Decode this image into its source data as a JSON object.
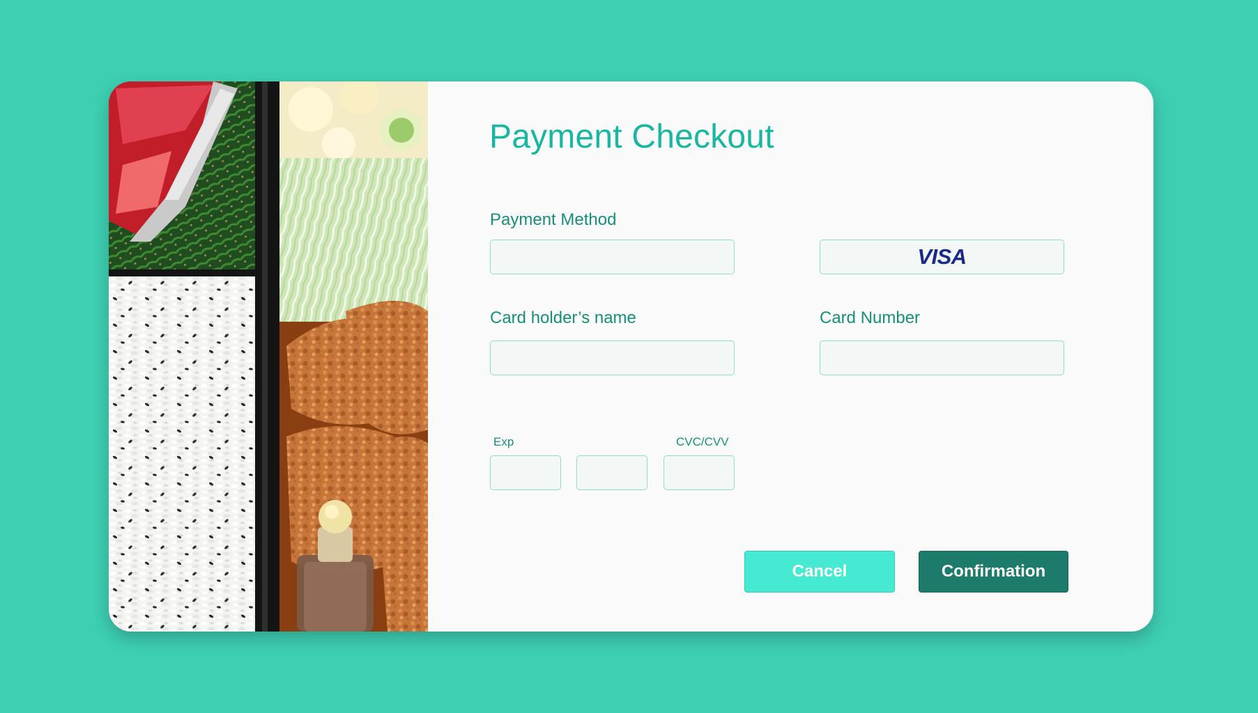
{
  "page": {
    "title": "Payment Checkout"
  },
  "form": {
    "payment_method": {
      "label": "Payment Method",
      "value": "",
      "card_brand": "VISA"
    },
    "card_holder": {
      "label": "Card holder’s name",
      "value": ""
    },
    "card_number": {
      "label": "Card Number",
      "value": ""
    },
    "expiry": {
      "label": "Exp",
      "month_value": "",
      "year_value": ""
    },
    "cvc": {
      "label": "CVC/CVV",
      "value": ""
    }
  },
  "buttons": {
    "cancel": "Cancel",
    "confirm": "Confirmation"
  },
  "colors": {
    "background": "#3ecfb3",
    "title": "#18b7a2",
    "label": "#178f7a",
    "field_border": "#8fdccd",
    "cancel_button": "#46ead2",
    "confirm_button": "#1d7b6b",
    "visa_blue": "#1a2a8a"
  },
  "icons": {
    "photo": "bento-box-photo",
    "card_brand": "visa-logo"
  }
}
